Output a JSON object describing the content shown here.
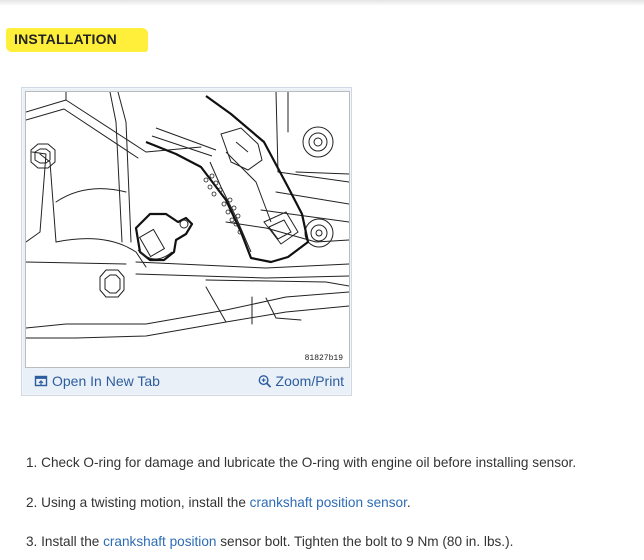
{
  "heading": "INSTALLATION",
  "figure": {
    "id_label": "81827b19",
    "open_tab_label": "Open In New Tab",
    "zoom_label": "Zoom/Print"
  },
  "steps": [
    {
      "number": "1.",
      "text": "Check O-ring for damage and lubricate the O-ring with engine oil before installing sensor."
    },
    {
      "number": "2.",
      "before": "Using a twisting motion, install the ",
      "link": "crankshaft position sensor",
      "after": "."
    },
    {
      "number": "3.",
      "before": "Install the ",
      "link": "crankshaft position",
      "after": " sensor bolt. Tighten the bolt to 9 Nm (80 in. lbs.)."
    }
  ],
  "colors": {
    "highlight": "#ffef3a",
    "link": "#2d6cb5",
    "card_bg": "#eaf0f8"
  },
  "icons": {
    "open_tab": "open-new-tab-icon",
    "zoom": "zoom-magnifier-icon"
  }
}
